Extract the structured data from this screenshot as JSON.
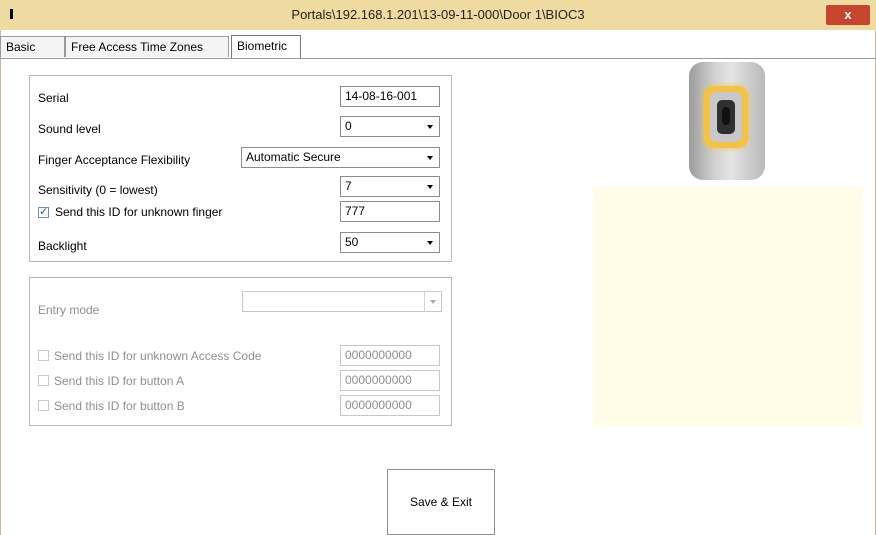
{
  "window": {
    "title": "Portals\\192.168.1.201\\13-09-11-000\\Door 1\\BIOC3",
    "close_label": "x"
  },
  "tabs": [
    {
      "label": "Basic"
    },
    {
      "label": "Free Access Time Zones"
    },
    {
      "label": "Biometric"
    }
  ],
  "active_tab": "Biometric",
  "biometric": {
    "serial": {
      "label": "Serial",
      "value": "14-08-16-001"
    },
    "sound_level": {
      "label": "Sound level",
      "value": "0"
    },
    "finger_acceptance": {
      "label": "Finger Acceptance Flexibility",
      "value": "Automatic Secure"
    },
    "sensitivity": {
      "label": "Sensitivity (0 = lowest)",
      "value": "7"
    },
    "unknown_finger": {
      "label": "Send this ID for unknown finger",
      "value": "777",
      "checked": true
    },
    "backlight": {
      "label": "Backlight",
      "value": "50"
    }
  },
  "keypad": {
    "entry_mode": {
      "label": "Entry mode",
      "value": ""
    },
    "unknown_code": {
      "label": "Send this ID for unknown Access Code",
      "value": "0000000000",
      "checked": false
    },
    "button_a": {
      "label": "Send this ID for button A",
      "value": "0000000000",
      "checked": false
    },
    "button_b": {
      "label": "Send this ID for button B",
      "value": "0000000000",
      "checked": false
    }
  },
  "actions": {
    "save_exit": "Save & Exit"
  },
  "colors": {
    "titlebar": "#efdba2",
    "close": "#c7442f",
    "preview_panel": "#fffde8",
    "device_ring": "#f3c24a"
  }
}
